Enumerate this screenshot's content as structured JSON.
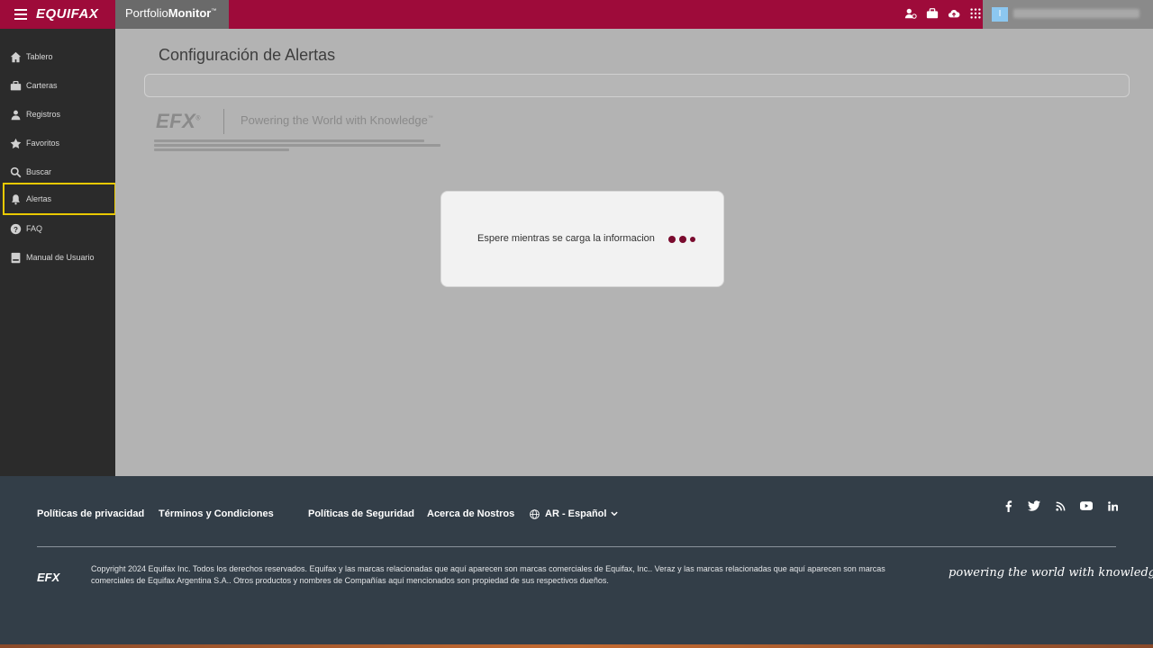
{
  "topbar": {
    "brand": "EQUIFAX",
    "product_light": "Portfolio",
    "product_bold": "Monitor",
    "product_tm": "™",
    "icons": [
      "user-settings-icon",
      "briefcase-icon",
      "cloud-upload-icon",
      "apps-grid-icon"
    ],
    "user_initial": "I"
  },
  "sidebar": {
    "items": [
      {
        "label": "Tablero",
        "icon": "home-icon"
      },
      {
        "label": "Carteras",
        "icon": "briefcase-icon"
      },
      {
        "label": "Registros",
        "icon": "users-icon"
      },
      {
        "label": "Favoritos",
        "icon": "star-icon"
      },
      {
        "label": "Buscar",
        "icon": "search-icon"
      },
      {
        "label": "Alertas",
        "icon": "bell-icon",
        "active": true
      },
      {
        "label": "FAQ",
        "icon": "question-icon"
      },
      {
        "label": "Manual de Usuario",
        "icon": "book-icon"
      }
    ]
  },
  "main": {
    "title": "Configuración de Alertas",
    "efx_logo": "EFX",
    "tagline": "Powering the World with Knowledge",
    "tm": "™"
  },
  "modal": {
    "message": "Espere mientras se carga la informacion"
  },
  "footer": {
    "links": [
      "Políticas de privacidad",
      "Términos y Condiciones",
      "Políticas de Seguridad",
      "Acerca de Nostros"
    ],
    "language": "AR - Español",
    "socials": [
      "facebook-icon",
      "twitter-icon",
      "rss-icon",
      "youtube-icon",
      "linkedin-icon"
    ],
    "efx": "EFX",
    "copyright": "Copyright 2024 Equifax Inc. Todos los derechos reservados. Equifax y las marcas relacionadas que aquí aparecen son marcas comerciales de Equifax, Inc.. Veraz y las marcas relacionadas que aquí aparecen son marcas comerciales de Equifax Argentina S.A.. Otros productos y nombres de Compañías aquí mencionados son propiedad de sus respectivos dueños.",
    "powering": "powering the world with knowledge",
    "tm": "™"
  },
  "colors": {
    "brand": "#9e0b3a",
    "sidebar": "#2b2b2b",
    "footer": "#333e48",
    "active_outline": "#e9c900",
    "loader_dot": "#7a0b2e"
  }
}
